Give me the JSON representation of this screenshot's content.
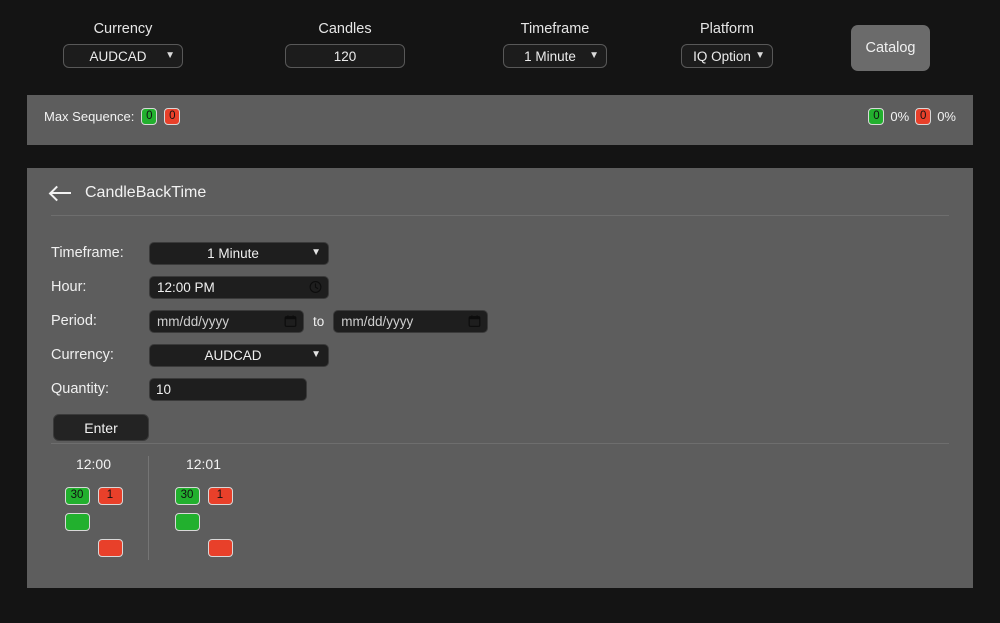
{
  "toolbar": {
    "groups": [
      {
        "label": "Currency",
        "value": "AUDCAD",
        "type": "select",
        "icon": "chevron-down-icon"
      },
      {
        "label": "Candles",
        "value": "120",
        "type": "text",
        "icon": ""
      },
      {
        "label": "Timeframe",
        "value": "1 Minute",
        "type": "select",
        "icon": "chevron-down-icon"
      },
      {
        "label": "Platform",
        "value": "IQ Option",
        "type": "select",
        "icon": "chevron-down-icon"
      }
    ],
    "catalog_label": "Catalog"
  },
  "sequence_bar": {
    "label": "Max Sequence:",
    "green_count": "0",
    "red_count": "0",
    "stats": {
      "green_count": "0",
      "green_pct": "0%",
      "red_count": "0",
      "red_pct": "0%"
    }
  },
  "panel": {
    "back_icon": "arrow-left-icon",
    "title": "CandleBackTime",
    "form": {
      "timeframe": {
        "label": "Timeframe:",
        "value": "1 Minute"
      },
      "hour": {
        "label": "Hour:",
        "value": "12:00 PM",
        "icon": "clock-icon"
      },
      "period": {
        "label": "Period:",
        "from_placeholder": "mm/dd/yyyy",
        "to_word": "to",
        "to_placeholder": "mm/dd/yyyy",
        "icon": "calendar-icon"
      },
      "currency": {
        "label": "Currency:",
        "value": "AUDCAD"
      },
      "quantity": {
        "label": "Quantity:",
        "value": "10"
      },
      "submit_label": "Enter"
    },
    "results": [
      {
        "time": "12:00",
        "rows": [
          {
            "left": {
              "color": "green",
              "text": "30"
            },
            "right": {
              "color": "red",
              "text": "1"
            }
          },
          {
            "left": {
              "color": "green",
              "text": ""
            },
            "right": null
          },
          {
            "left": null,
            "right": {
              "color": "red",
              "text": ""
            }
          }
        ]
      },
      {
        "time": "12:01",
        "rows": [
          {
            "left": {
              "color": "green",
              "text": "30"
            },
            "right": {
              "color": "red",
              "text": "1"
            }
          },
          {
            "left": {
              "color": "green",
              "text": ""
            },
            "right": null
          },
          {
            "left": null,
            "right": {
              "color": "red",
              "text": ""
            }
          }
        ]
      }
    ]
  },
  "colors": {
    "page_background": "#141414",
    "panel_background": "#5d5d5d",
    "field_background": "#1e1e1e",
    "accent_green": "#22b02e",
    "accent_red": "#e8402a",
    "catalog_button": "#6b6b6b"
  }
}
